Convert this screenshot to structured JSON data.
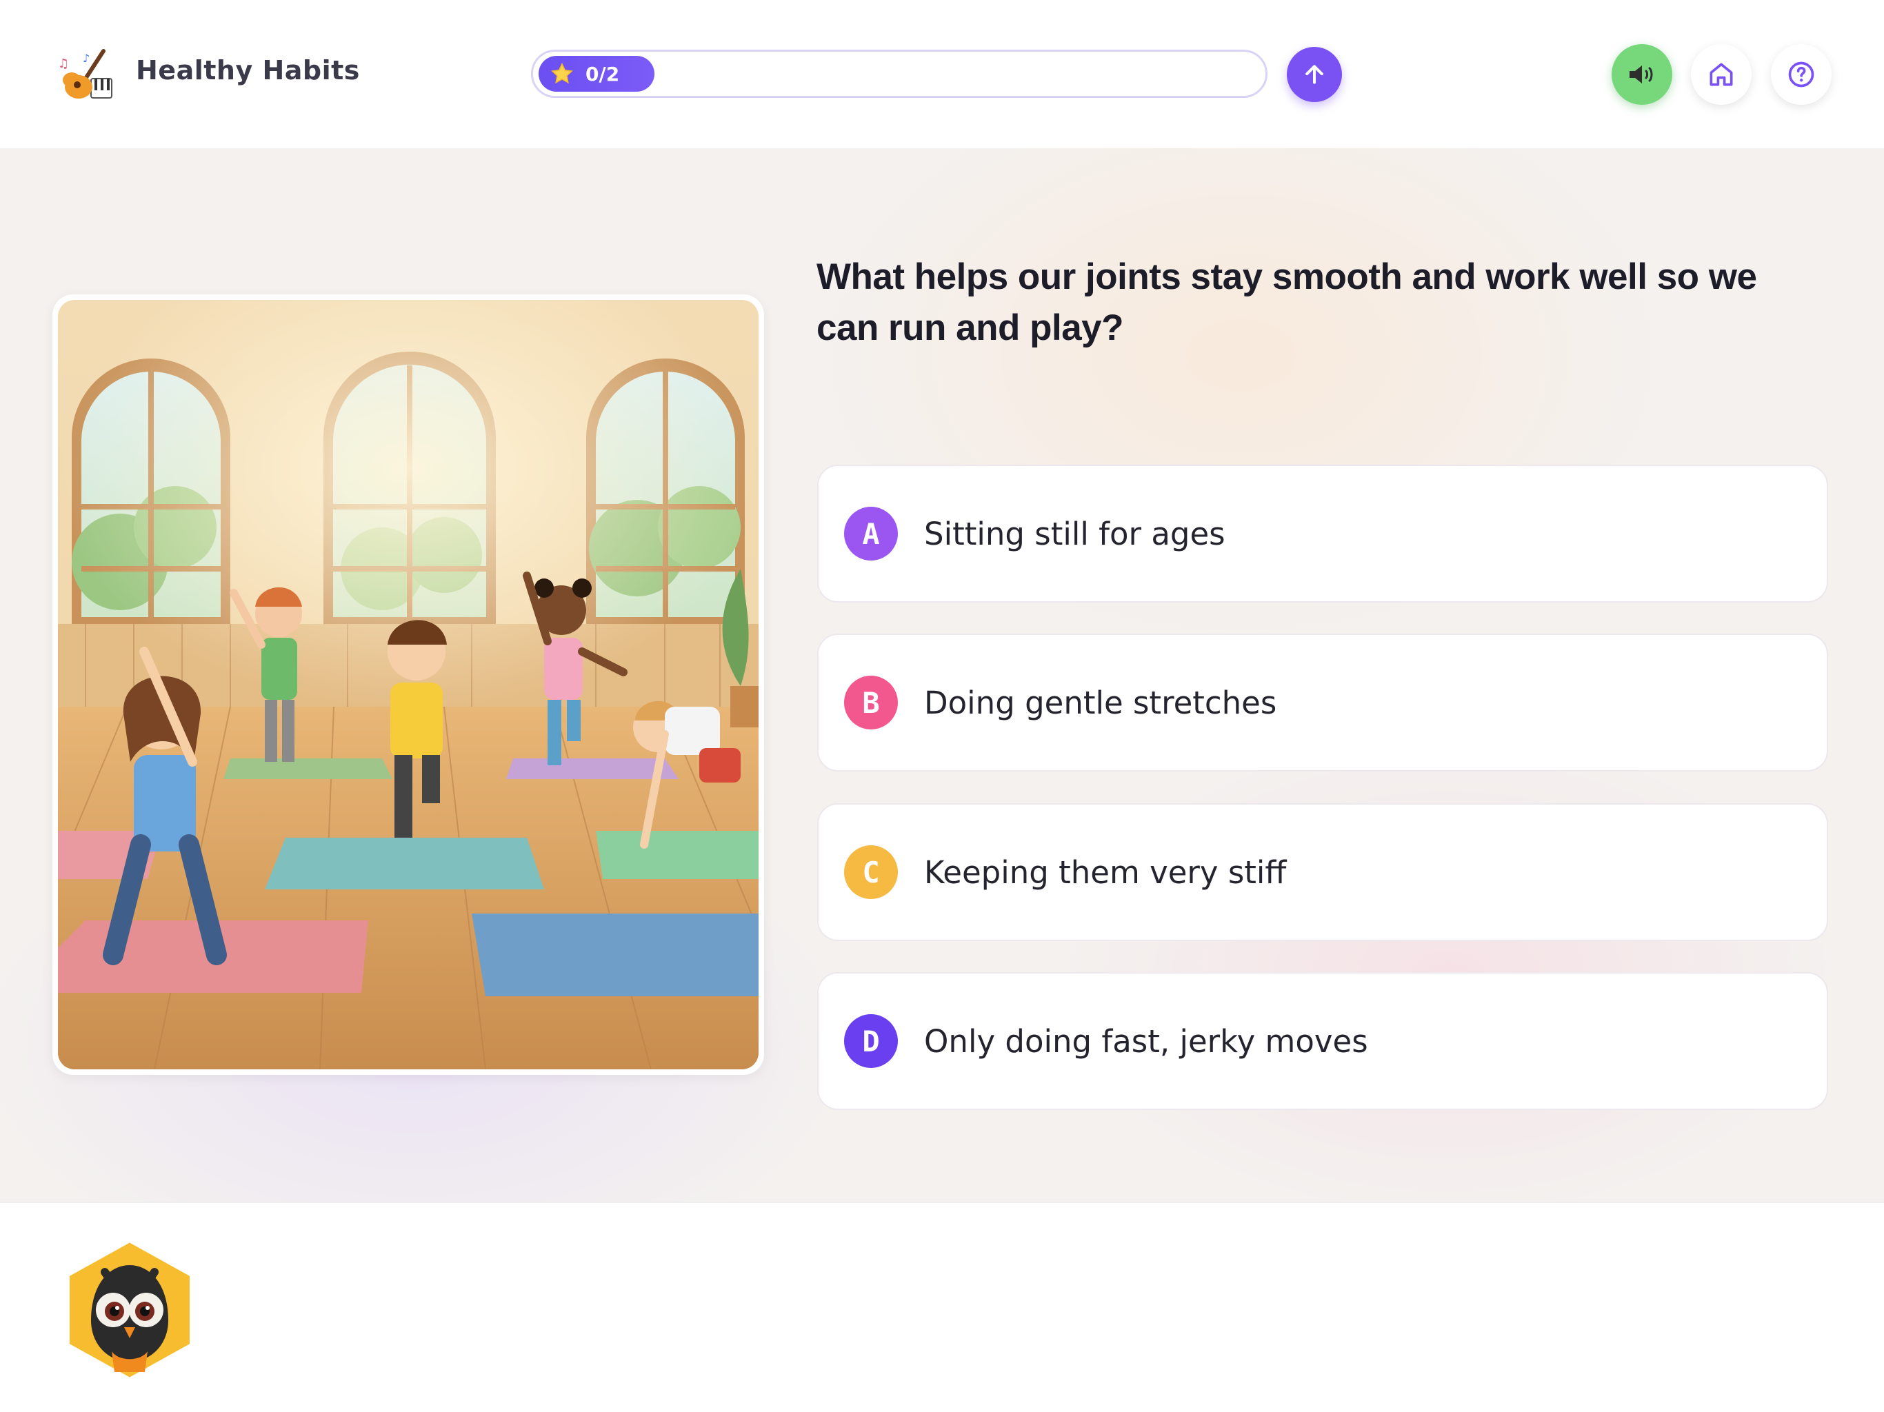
{
  "header": {
    "title": "Healthy Habits",
    "logo_icon": "guitar-music-icon",
    "progress_text": "0/2",
    "progress_icon": "star-icon",
    "submit_icon": "arrow-up-icon",
    "buttons": [
      {
        "name": "sound",
        "icon": "speaker-icon"
      },
      {
        "name": "home",
        "icon": "home-icon"
      },
      {
        "name": "help",
        "icon": "question-circle-icon"
      }
    ]
  },
  "main": {
    "illustration": "children-stretching-yoga-illustration",
    "question": "What helps our joints stay smooth and work well so we can run and play?",
    "options": [
      {
        "letter": "A",
        "text": "Sitting still for ages",
        "color": "#9b55f0"
      },
      {
        "letter": "B",
        "text": "Doing gentle stretches",
        "color": "#f2588e"
      },
      {
        "letter": "C",
        "text": "Keeping them very stiff",
        "color": "#f6b942"
      },
      {
        "letter": "D",
        "text": "Only doing fast, jerky moves",
        "color": "#6a3ff0"
      }
    ]
  },
  "footer": {
    "mascot": "owl-mascot-icon"
  },
  "colors": {
    "accent": "#7a52f4",
    "progress_border": "#d9d3f6",
    "sound_green": "#76d87a"
  }
}
